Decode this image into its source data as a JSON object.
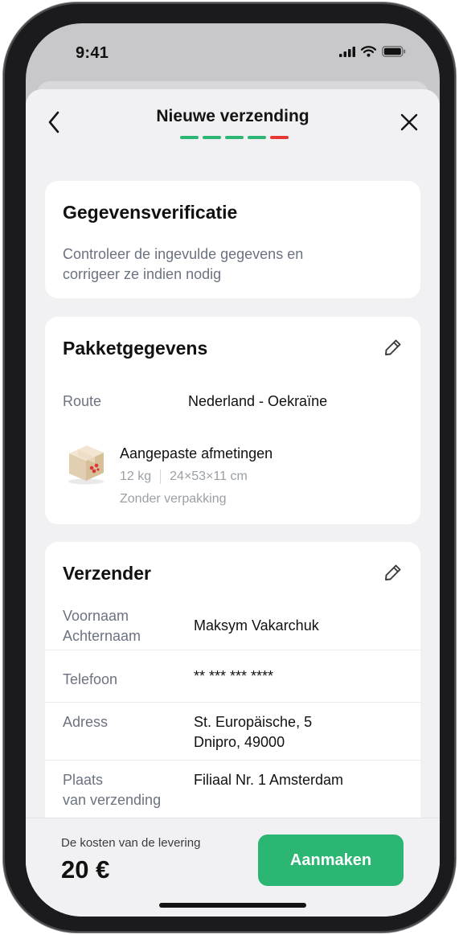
{
  "status_bar": {
    "time": "9:41"
  },
  "header": {
    "title": "Nieuwe verzending",
    "steps_total": 5,
    "current_step": 5
  },
  "verification": {
    "title": "Gegevensverificatie",
    "description_line1": "Controleer de ingevulde gegevens en",
    "description_line2": "corrigeer ze indien nodig"
  },
  "package": {
    "title": "Pakketgegevens",
    "route_label": "Route",
    "route_value": "Nederland - Oekraïne",
    "size_title": "Aangepaste afmetingen",
    "weight": "12 kg",
    "dimensions": "24×53×11 cm",
    "packaging": "Zonder verpakking"
  },
  "sender": {
    "title": "Verzender",
    "rows": [
      {
        "label_line1": "Voornaam",
        "label_line2": "Achternaam",
        "value_line1": "Maksym Vakarchuk",
        "value_line2": ""
      },
      {
        "label_line1": "Telefoon",
        "label_line2": "",
        "value_line1": "** *** *** ****",
        "value_line2": ""
      },
      {
        "label_line1": "Adress",
        "label_line2": "",
        "value_line1": "St. Europäische, 5",
        "value_line2": "Dnipro, 49000"
      },
      {
        "label_line1": "Plaats",
        "label_line2": "van verzending",
        "value_line1": "Filiaal Nr. 1 Amsterdam",
        "value_line2": ""
      }
    ]
  },
  "footer": {
    "cost_label": "De kosten van de levering",
    "cost_value": "20 €",
    "create_label": "Aanmaken"
  },
  "colors": {
    "accent": "#2bb673",
    "active_step": "#e53935",
    "background": "#f1f1f3"
  },
  "icons": [
    "back-chevron-icon",
    "close-icon",
    "edit-pencil-icon",
    "package-box-icon",
    "signal-icon",
    "wifi-icon",
    "battery-icon"
  ]
}
